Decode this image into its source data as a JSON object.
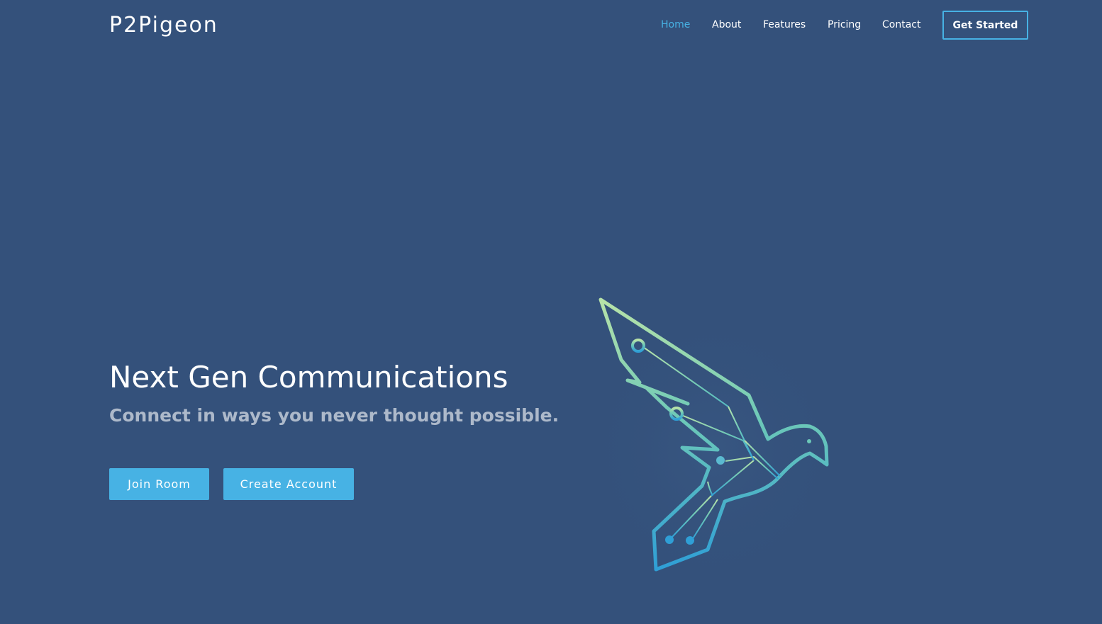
{
  "brand": {
    "name": "P2Pigeon"
  },
  "nav": {
    "items": [
      {
        "label": "Home",
        "active": true
      },
      {
        "label": "About",
        "active": false
      },
      {
        "label": "Features",
        "active": false
      },
      {
        "label": "Pricing",
        "active": false
      },
      {
        "label": "Contact",
        "active": false
      }
    ],
    "cta_label": "Get Started"
  },
  "hero": {
    "title": "Next Gen Communications",
    "subtitle": "Connect in ways you never thought possible.",
    "buttons": {
      "join_label": "Join Room",
      "create_label": "Create Account"
    },
    "image_icon": "circuit-pigeon-icon"
  },
  "colors": {
    "background": "#34517b",
    "accent": "#47b2e4",
    "text": "#ffffff",
    "subtitle_text": "rgba(255,255,255,0.6)",
    "logo_gradient_top": "#b8e3a8",
    "logo_gradient_mid": "#6cc8b8",
    "logo_gradient_bottom": "#2f9fd6"
  }
}
